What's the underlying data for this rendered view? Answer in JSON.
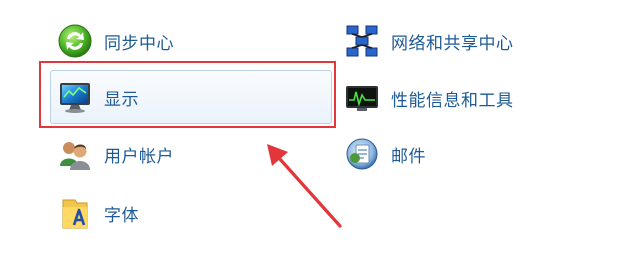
{
  "left_column": [
    {
      "id": "sync-center",
      "label": "同步中心",
      "icon": "sync-center-icon"
    },
    {
      "id": "display",
      "label": "显示",
      "icon": "display-monitor-icon",
      "selected": true
    },
    {
      "id": "user-accounts",
      "label": "用户帐户",
      "icon": "user-accounts-icon"
    },
    {
      "id": "fonts",
      "label": "字体",
      "icon": "fonts-folder-icon"
    }
  ],
  "right_column": [
    {
      "id": "network-sharing",
      "label": "网络和共享中心",
      "icon": "network-icon"
    },
    {
      "id": "performance",
      "label": "性能信息和工具",
      "icon": "performance-monitor-icon"
    },
    {
      "id": "mail",
      "label": "邮件",
      "icon": "mail-icon"
    }
  ],
  "annotation": {
    "box_color": "#e2363a",
    "arrow_color": "#e2363a"
  }
}
